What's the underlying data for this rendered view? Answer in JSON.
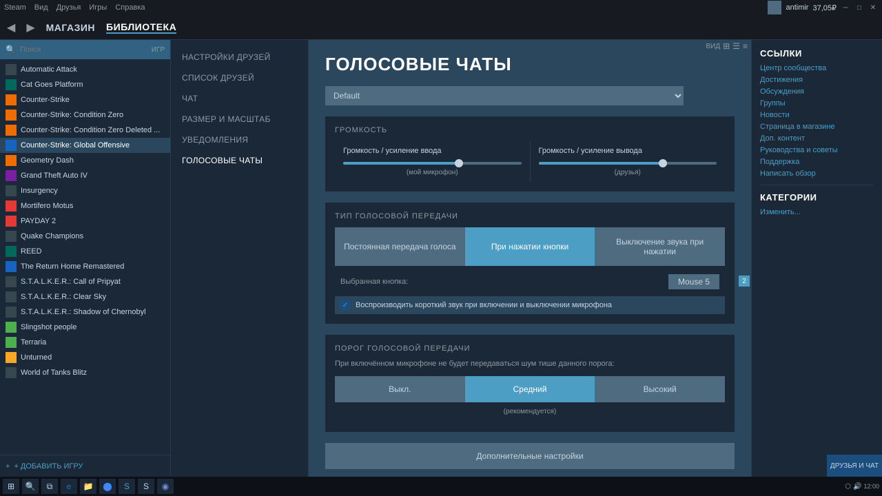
{
  "titlebar": {
    "menus": [
      "Steam",
      "Вид",
      "Друзья",
      "Игры",
      "Справка"
    ],
    "user": "antimir",
    "balance": "37,05₽",
    "close_btn": "✕",
    "minimize_btn": "─",
    "maximize_btn": "□"
  },
  "navbar": {
    "back_arrow": "◀",
    "forward_arrow": "▶",
    "items": [
      {
        "label": "МАГАЗИН",
        "active": false
      },
      {
        "label": "БИБЛИОТЕКА",
        "active": true
      }
    ]
  },
  "search": {
    "placeholder": "Поиск",
    "games_label": "ИГР"
  },
  "games": [
    {
      "name": "Automatic Attack",
      "color": "dark"
    },
    {
      "name": "Cat Goes Platform",
      "color": "teal"
    },
    {
      "name": "Counter-Strike",
      "color": "orange"
    },
    {
      "name": "Counter-Strike: Condition Zero",
      "color": "orange"
    },
    {
      "name": "Counter-Strike: Condition Zero Deleted ...",
      "color": "orange"
    },
    {
      "name": "Counter-Strike: Global Offensive",
      "color": "blue",
      "active": true
    },
    {
      "name": "Geometry Dash",
      "color": "orange"
    },
    {
      "name": "Grand Theft Auto IV",
      "color": "purple"
    },
    {
      "name": "Insurgency",
      "color": "dark"
    },
    {
      "name": "Mortifero Motus",
      "color": "red"
    },
    {
      "name": "PAYDAY 2",
      "color": "red"
    },
    {
      "name": "Quake Champions",
      "color": "dark"
    },
    {
      "name": "REED",
      "color": "teal"
    },
    {
      "name": "The Return Home Remastered",
      "color": "blue"
    },
    {
      "name": "S.T.A.L.K.E.R.: Call of Pripyat",
      "color": "dark"
    },
    {
      "name": "S.T.A.L.K.E.R.: Clear Sky",
      "color": "dark"
    },
    {
      "name": "S.T.A.L.K.E.R.: Shadow of Chernobyl",
      "color": "dark"
    },
    {
      "name": "Slingshot people",
      "color": "green"
    },
    {
      "name": "Terraria",
      "color": "green"
    },
    {
      "name": "Unturned",
      "color": "yellow"
    },
    {
      "name": "World of Tanks Blitz",
      "color": "dark"
    }
  ],
  "add_game_label": "+ ДОБАВИТЬ ИГРУ",
  "settings_nav": {
    "items": [
      {
        "label": "НАСТРОЙКИ ДРУЗЕЙ",
        "active": false
      },
      {
        "label": "СПИСОК ДРУЗЕЙ",
        "active": false
      },
      {
        "label": "ЧАТ",
        "active": false
      },
      {
        "label": "РАЗМЕР И МАСШТАБ",
        "active": false
      },
      {
        "label": "УВЕДОМЛЕНИЯ",
        "active": false
      },
      {
        "label": "ГОЛОСОВЫЕ ЧАТЫ",
        "active": true
      }
    ]
  },
  "content": {
    "page_title": "ГОЛОСОВЫЕ ЧАТЫ",
    "dropdown_default": "Default",
    "volume_section_title": "ГРОМКОСТЬ",
    "input_volume_label": "Громкость / усиление ввода",
    "input_volume_sub": "(мой микрофон)",
    "input_volume_pct": 65,
    "output_volume_label": "Громкость / усиление вывода",
    "output_volume_sub": "(друзья)",
    "output_volume_pct": 70,
    "voice_type_title": "ТИП ГОЛОСОВОЙ ПЕРЕДАЧИ",
    "voice_buttons": [
      {
        "label": "Постоянная передача голоса",
        "active": false
      },
      {
        "label": "При нажатии кнопки",
        "active": true
      },
      {
        "label": "Выключение звука при нажатии",
        "active": false
      }
    ],
    "selected_key_label": "Выбранная кнопка:",
    "selected_key_value": "Mouse 5",
    "checkbox_label": "Воспроизводить короткий звук при включении и выключении микрофона",
    "checkbox_checked": true,
    "threshold_title": "ПОРОГ ГОЛОСОВОЙ ПЕРЕДАЧИ",
    "threshold_desc": "При включённом микрофоне не будет передаваться шум тише данного порога:",
    "threshold_buttons": [
      {
        "label": "Выкл.",
        "active": false
      },
      {
        "label": "Средний",
        "active": true
      },
      {
        "label": "Высокий",
        "active": false
      }
    ],
    "recommended_label": "(рекомендуется)",
    "additional_btn_label": "Дополнительные настройки"
  },
  "right_panel": {
    "links_title": "ССЫЛКИ",
    "links": [
      "Центр сообщества",
      "Достижения",
      "Обсуждения",
      "Группы",
      "Новости",
      "Страница в магазине",
      "Доп. контент",
      "Руководства и советы",
      "Поддержка",
      "Написать обзор"
    ],
    "categories_title": "КАТЕГОРИИ",
    "categories_link": "Изменить..."
  },
  "view_label": "ВИД",
  "friends_chat_label": "ДРУЗЬЯ И ЧАТ",
  "scroll_number": "2"
}
